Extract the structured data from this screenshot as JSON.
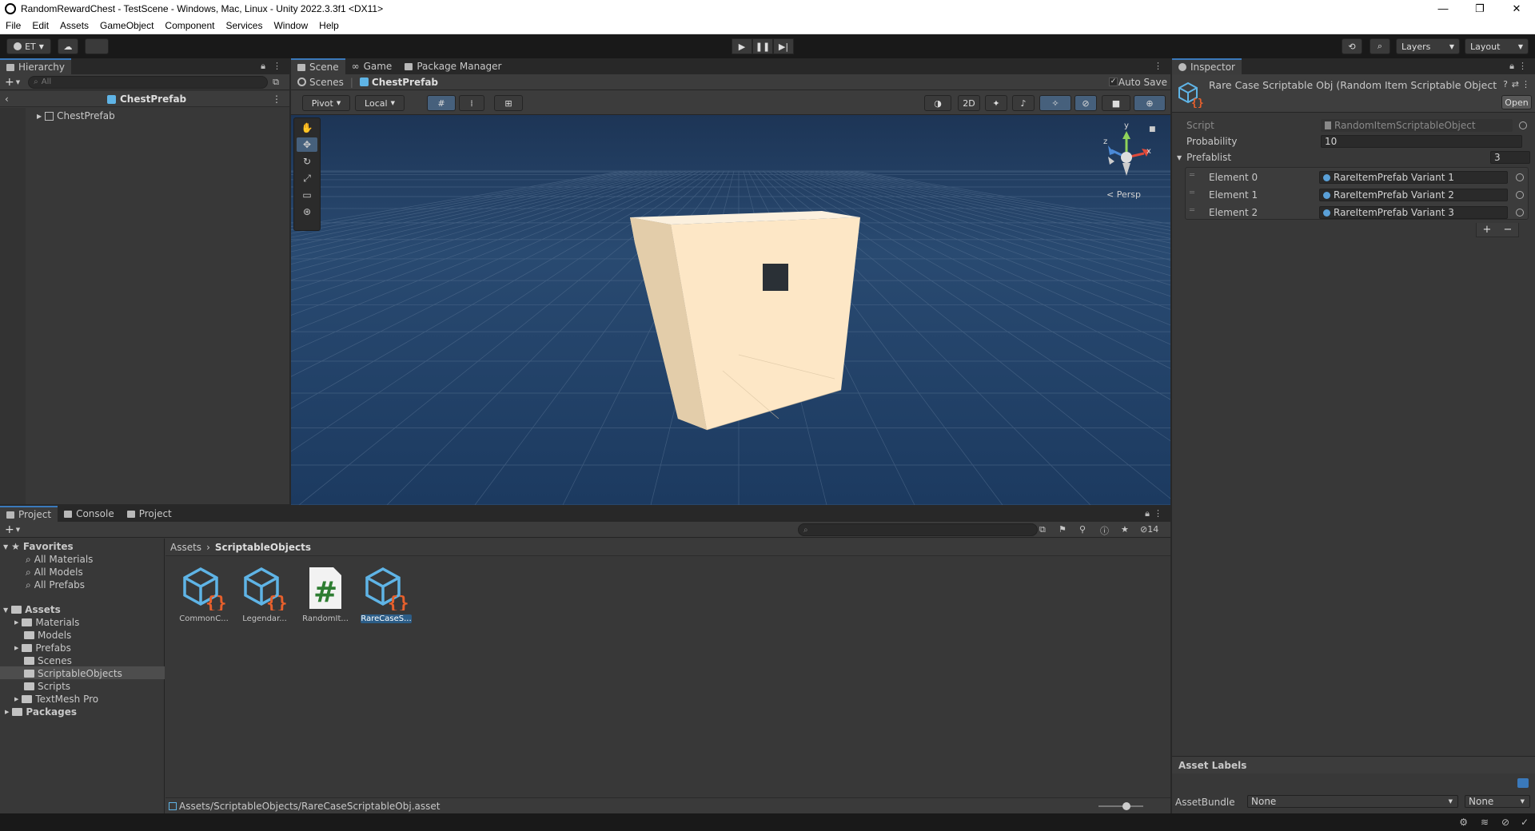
{
  "window": {
    "title": "RandomRewardChest - TestScene - Windows, Mac, Linux - Unity 2022.3.3f1 <DX11>",
    "minimize": "—",
    "maximize": "❐",
    "close": "✕"
  },
  "menu": [
    "File",
    "Edit",
    "Assets",
    "GameObject",
    "Component",
    "Services",
    "Window",
    "Help"
  ],
  "toolbar": {
    "account": "ET",
    "layers": "Layers",
    "layout": "Layout"
  },
  "hierarchy": {
    "tab": "Hierarchy",
    "search_placeholder": "All",
    "root": "ChestPrefab",
    "child": "ChestPrefab"
  },
  "scene": {
    "tabs": [
      "Scene",
      "Game",
      "Package Manager"
    ],
    "breadcrumb_scenes": "Scenes",
    "breadcrumb_prefab": "ChestPrefab",
    "auto_save": "Auto Save",
    "pivot": "Pivot",
    "local": "Local",
    "mode_2d": "2D",
    "persp": "Persp",
    "gizmo_axes": {
      "y": "y",
      "z": "z",
      "x": "x"
    }
  },
  "inspector": {
    "tab": "Inspector",
    "title": "Rare Case Scriptable Obj (Random Item Scriptable Object",
    "open_button": "Open",
    "script_label": "Script",
    "script_value": "RandomItemScriptableObject",
    "probability_label": "Probability",
    "probability_value": "10",
    "prefablist_label": "Prefablist",
    "prefablist_count": "3",
    "elements": [
      {
        "label": "Element 0",
        "value": "RareItemPrefab Variant 1"
      },
      {
        "label": "Element 1",
        "value": "RareItemPrefab Variant 2"
      },
      {
        "label": "Element 2",
        "value": "RareItemPrefab Variant 3"
      }
    ],
    "plus": "+",
    "minus": "−",
    "asset_labels": "Asset Labels",
    "assetbundle_label": "AssetBundle",
    "assetbundle_value": "None",
    "assetbundle_variant": "None"
  },
  "project": {
    "tabs": [
      "Project",
      "Console",
      "Project"
    ],
    "hidden_count": "14",
    "favorites": "Favorites",
    "favorite_items": [
      "All Materials",
      "All Models",
      "All Prefabs"
    ],
    "assets": "Assets",
    "asset_folders": [
      "Materials",
      "Models",
      "Prefabs",
      "Scenes",
      "ScriptableObjects",
      "Scripts",
      "TextMesh Pro"
    ],
    "packages": "Packages",
    "breadcrumb_root": "Assets",
    "breadcrumb_current": "ScriptableObjects",
    "items": [
      {
        "label": "CommonC...",
        "icon": "scriptable-object-icon"
      },
      {
        "label": "Legendar...",
        "icon": "scriptable-object-icon"
      },
      {
        "label": "RandomIt...",
        "icon": "csharp-script-icon"
      },
      {
        "label": "RareCaseS...",
        "icon": "scriptable-object-icon"
      }
    ],
    "footer_path": "Assets/ScriptableObjects/RareCaseScriptableObj.asset"
  },
  "colors": {
    "accent": "#3a79bb",
    "scene_bg": "#1f3a5e",
    "cube_front": "#fde6c2",
    "cube_side": "#e9d4b1"
  }
}
